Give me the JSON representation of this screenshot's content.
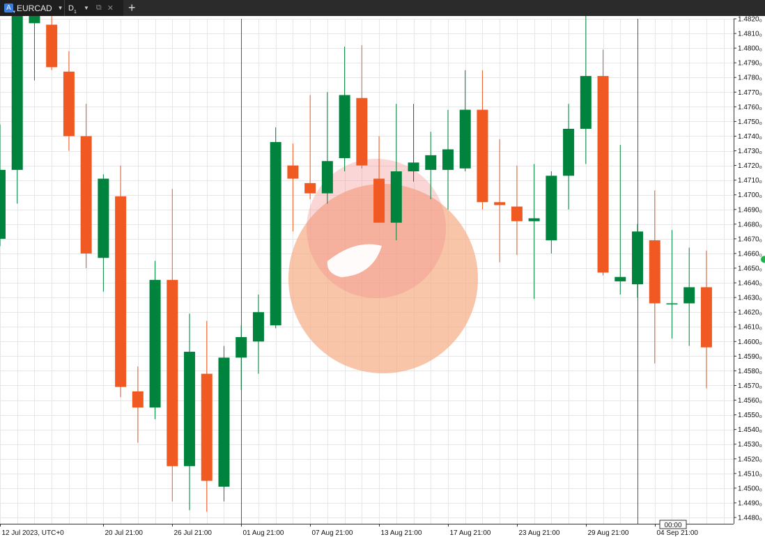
{
  "toolbar": {
    "symbol_badge": "A",
    "symbol": "EURCAD",
    "timeframe": "D",
    "timeframe_sub": "1",
    "popout_icon": "popout-icon",
    "close_icon": "close-icon",
    "add_tab_icon": "plus-icon"
  },
  "colors": {
    "bull": "#00843d",
    "bear": "#f05a22",
    "grid": "#e6e6e6",
    "axis": "#333333",
    "marker": "#1db34a"
  },
  "chart_data": {
    "type": "candlestick",
    "symbol": "EURCAD",
    "timeframe": "D1",
    "ylim": [
      1.4475,
      1.483
    ],
    "y_ticks": [
      1.448,
      1.449,
      1.45,
      1.451,
      1.452,
      1.453,
      1.454,
      1.455,
      1.456,
      1.457,
      1.458,
      1.459,
      1.46,
      1.461,
      1.462,
      1.463,
      1.464,
      1.465,
      1.466,
      1.467,
      1.468,
      1.469,
      1.47,
      1.471,
      1.472,
      1.473,
      1.474,
      1.475,
      1.476,
      1.477,
      1.478,
      1.479,
      1.48,
      1.481,
      1.482
    ],
    "y_tick_labels": [
      "1.4480₀",
      "1.4490₀",
      "1.4500₀",
      "1.4510₀",
      "1.4520₀",
      "1.4530₀",
      "1.4540₀",
      "1.4550₀",
      "1.4560₀",
      "1.4570₀",
      "1.4580₀",
      "1.4590₀",
      "1.4600₀",
      "1.4610₀",
      "1.4620₀",
      "1.4630₀",
      "1.4640₀",
      "1.4650₀",
      "1.4660₀",
      "1.4670₀",
      "1.4680₀",
      "1.4690₀",
      "1.4700₀",
      "1.4710₀",
      "1.4720₀",
      "1.4730₀",
      "1.4740₀",
      "1.4750₀",
      "1.4760₀",
      "1.4770₀",
      "1.4780₀",
      "1.4790₀",
      "1.4800₀",
      "1.4810₀",
      "1.4820₀"
    ],
    "x_labels": [
      {
        "bar": 0,
        "label": "12 Jul 2023, UTC+0"
      },
      {
        "bar": 6,
        "label": "20 Jul 21:00"
      },
      {
        "bar": 10,
        "label": "26 Jul 21:00"
      },
      {
        "bar": 14,
        "label": "01 Aug 21:00"
      },
      {
        "bar": 18,
        "label": "07 Aug 21:00"
      },
      {
        "bar": 22,
        "label": "13 Aug 21:00"
      },
      {
        "bar": 26,
        "label": "17 Aug 21:00"
      },
      {
        "bar": 30,
        "label": "23 Aug 21:00"
      },
      {
        "bar": 34,
        "label": "29 Aug 21:00"
      },
      {
        "bar": 38,
        "label": "04 Sep 21:00"
      }
    ],
    "separators": [
      14,
      37
    ],
    "cursor_time_label": "00:00",
    "candles": [
      {
        "o": 1.467,
        "h": 1.4748,
        "l": 1.4665,
        "c": 1.4717
      },
      {
        "o": 1.4717,
        "h": 1.487,
        "l": 1.4694,
        "c": 1.4845
      },
      {
        "o": 1.4817,
        "h": 1.4851,
        "l": 1.4778,
        "c": 1.4825
      },
      {
        "o": 1.4816,
        "h": 1.484,
        "l": 1.4785,
        "c": 1.4787
      },
      {
        "o": 1.4784,
        "h": 1.4798,
        "l": 1.473,
        "c": 1.474
      },
      {
        "o": 1.474,
        "h": 1.4762,
        "l": 1.465,
        "c": 1.466
      },
      {
        "o": 1.4657,
        "h": 1.4714,
        "l": 1.4634,
        "c": 1.4711
      },
      {
        "o": 1.4699,
        "h": 1.472,
        "l": 1.4562,
        "c": 1.4569
      },
      {
        "o": 1.4566,
        "h": 1.4583,
        "l": 1.4531,
        "c": 1.4555
      },
      {
        "o": 1.4555,
        "h": 1.4655,
        "l": 1.4547,
        "c": 1.4642
      },
      {
        "o": 1.4642,
        "h": 1.4704,
        "l": 1.4491,
        "c": 1.4515
      },
      {
        "o": 1.4515,
        "h": 1.4619,
        "l": 1.4485,
        "c": 1.4593
      },
      {
        "o": 1.4578,
        "h": 1.4614,
        "l": 1.4484,
        "c": 1.4505
      },
      {
        "o": 1.4501,
        "h": 1.4597,
        "l": 1.4491,
        "c": 1.4589
      },
      {
        "o": 1.4589,
        "h": 1.4611,
        "l": 1.4567,
        "c": 1.4603
      },
      {
        "o": 1.46,
        "h": 1.4632,
        "l": 1.4578,
        "c": 1.462
      },
      {
        "o": 1.4611,
        "h": 1.4746,
        "l": 1.4609,
        "c": 1.4736
      },
      {
        "o": 1.472,
        "h": 1.4735,
        "l": 1.4675,
        "c": 1.4711
      },
      {
        "o": 1.4708,
        "h": 1.4768,
        "l": 1.4697,
        "c": 1.4701
      },
      {
        "o": 1.4701,
        "h": 1.477,
        "l": 1.4694,
        "c": 1.4723
      },
      {
        "o": 1.4725,
        "h": 1.4801,
        "l": 1.4716,
        "c": 1.4768
      },
      {
        "o": 1.4766,
        "h": 1.4802,
        "l": 1.4718,
        "c": 1.472
      },
      {
        "o": 1.4711,
        "h": 1.474,
        "l": 1.4681,
        "c": 1.4681
      },
      {
        "o": 1.4681,
        "h": 1.4762,
        "l": 1.4669,
        "c": 1.4716
      },
      {
        "o": 1.4716,
        "h": 1.4762,
        "l": 1.4709,
        "c": 1.4722
      },
      {
        "o": 1.4717,
        "h": 1.4743,
        "l": 1.4697,
        "c": 1.4727
      },
      {
        "o": 1.4717,
        "h": 1.4758,
        "l": 1.469,
        "c": 1.4731
      },
      {
        "o": 1.4718,
        "h": 1.4785,
        "l": 1.4716,
        "c": 1.4758
      },
      {
        "o": 1.4758,
        "h": 1.4785,
        "l": 1.469,
        "c": 1.4695
      },
      {
        "o": 1.4695,
        "h": 1.4738,
        "l": 1.4654,
        "c": 1.4693
      },
      {
        "o": 1.4692,
        "h": 1.472,
        "l": 1.4659,
        "c": 1.4682
      },
      {
        "o": 1.4682,
        "h": 1.4721,
        "l": 1.4629,
        "c": 1.4684
      },
      {
        "o": 1.4669,
        "h": 1.4716,
        "l": 1.466,
        "c": 1.4713
      },
      {
        "o": 1.4713,
        "h": 1.4762,
        "l": 1.469,
        "c": 1.4745
      },
      {
        "o": 1.4745,
        "h": 1.4824,
        "l": 1.4721,
        "c": 1.4781
      },
      {
        "o": 1.4781,
        "h": 1.4799,
        "l": 1.4645,
        "c": 1.4647
      },
      {
        "o": 1.4641,
        "h": 1.4734,
        "l": 1.4632,
        "c": 1.4644
      },
      {
        "o": 1.4639,
        "h": 1.468,
        "l": 1.463,
        "c": 1.4675
      },
      {
        "o": 1.4669,
        "h": 1.4703,
        "l": 1.4585,
        "c": 1.4626
      },
      {
        "o": 1.4626,
        "h": 1.4676,
        "l": 1.4602,
        "c": 1.4626
      },
      {
        "o": 1.4626,
        "h": 1.4664,
        "l": 1.4597,
        "c": 1.4637
      },
      {
        "o": 1.4637,
        "h": 1.4662,
        "l": 1.4568,
        "c": 1.4596
      }
    ]
  }
}
